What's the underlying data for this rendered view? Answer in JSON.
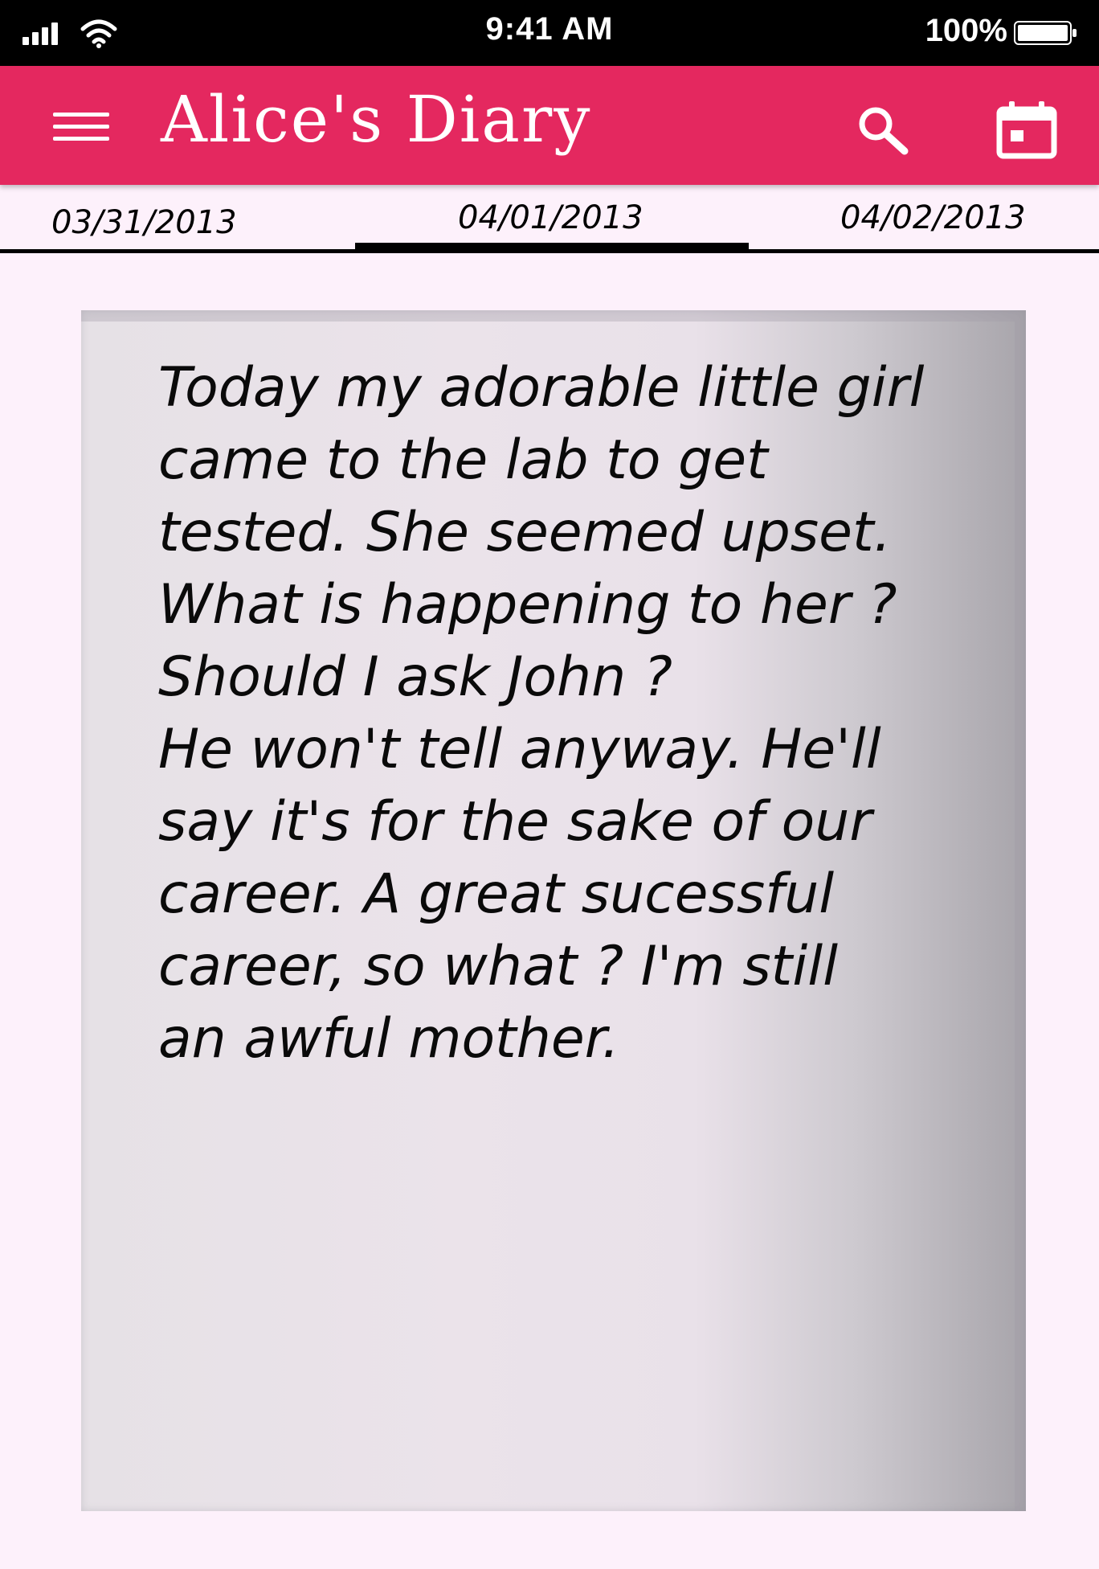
{
  "status_bar": {
    "time": "9:41 AM",
    "battery_percent": "100%",
    "signal_icon": "signal-bars-icon",
    "wifi_icon": "wifi-icon",
    "battery_icon": "battery-icon"
  },
  "header": {
    "title": "Alice's Diary",
    "background_color": "#e4285f",
    "menu_icon": "hamburger-menu-icon",
    "search_icon": "search-icon",
    "calendar_icon": "calendar-icon"
  },
  "date_tabs": {
    "previous": "03/31/2013",
    "current": "04/01/2013",
    "next": "04/02/2013",
    "active": "04/01/2013"
  },
  "entry": {
    "text": "Today my adorable little girl\ncame to the lab to get\ntested. She seemed upset.\nWhat is happening to her ?\nShould I ask John ?\nHe won't tell anyway. He'll\nsay it's for the sake of our\ncareer. A great sucessful\ncareer, so what ? I'm still\nan awful mother."
  }
}
